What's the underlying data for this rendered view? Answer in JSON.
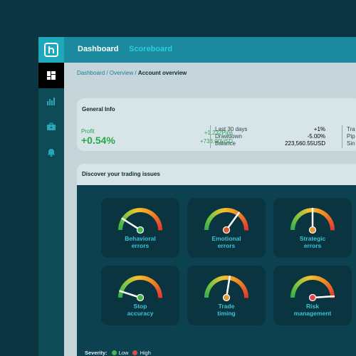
{
  "topbar": {
    "tabs": [
      "Dashboard",
      "Scoreboard"
    ]
  },
  "sidebar": {
    "icons": [
      "dashboard-icon",
      "chart-icon",
      "toolbox-icon",
      "bell-icon"
    ]
  },
  "breadcrumb": {
    "path": "Dashboard / Overview / ",
    "current": "Account overview"
  },
  "general_info": {
    "title": "General Info",
    "profit_label": "Profit",
    "profit_value": "+0.54%",
    "pips": "+1,232Pips",
    "usd": "+733.00USD",
    "metrics": [
      {
        "label": "Last 30 days",
        "value": "+1%",
        "color": "#27a84a"
      },
      {
        "label": "Drawdown",
        "value": "-5.00%",
        "color": "#e53935"
      },
      {
        "label": "Balance",
        "value": "223,560.55USD",
        "color": "#2f4a52"
      }
    ],
    "cut_labels": [
      "Tra",
      "Pip",
      "Sin"
    ]
  },
  "issues": {
    "title": "Discover your trading issues",
    "gauges": [
      {
        "line1": "Behavioral",
        "line2": "errors",
        "level": 0.18,
        "knob": "#45b649"
      },
      {
        "line1": "Emotional",
        "line2": "errors",
        "level": 0.7,
        "knob": "#e05a2b"
      },
      {
        "line1": "Strategic",
        "line2": "errors",
        "level": 0.5,
        "knob": "#e09a2b"
      },
      {
        "line1": "Stop",
        "line2": "accuracy",
        "level": 0.1,
        "knob": "#45b649"
      },
      {
        "line1": "Trade",
        "line2": "timing",
        "level": 0.55,
        "knob": "#e09a2b"
      },
      {
        "line1": "Risk",
        "line2": "management",
        "level": 0.98,
        "knob": "#e04848"
      }
    ],
    "severity": {
      "title": "Severity:",
      "low": "Low",
      "high": "High",
      "low_color": "#45b649",
      "high_color": "#e04848"
    }
  },
  "colors": {
    "brand": "#1b8a9e",
    "accent": "#2fcbe3",
    "positive": "#27a84a",
    "negative": "#e53935"
  }
}
